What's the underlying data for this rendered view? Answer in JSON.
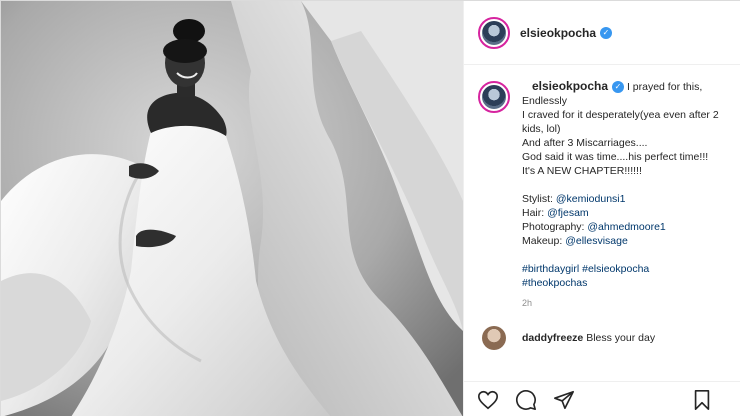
{
  "post": {
    "author": "elsieokpocha",
    "verified_glyph": "✓",
    "photo_alt": "black and white maternity portrait"
  },
  "caption": {
    "author": "elsieokpocha",
    "first_line_text": "I prayed for this,",
    "lines": [
      "Endlessly",
      "I craved for it desperately(yea even after 2 kids, lol)",
      "And after 3 Miscarriages....",
      "God said it was time....his perfect time!!!",
      "It's A NEW CHAPTER!!!!!!",
      ""
    ],
    "credits": [
      {
        "label": "Stylist:",
        "handle": "@kemiodunsi1"
      },
      {
        "label": "Hair:",
        "handle": "@fjesam"
      },
      {
        "label": "Photography:",
        "handle": "@ahmedmoore1"
      },
      {
        "label": "Makeup:",
        "handle": "@ellesvisage"
      }
    ],
    "hashtags_line1": "#birthdaygirl #elsieokpocha",
    "hashtags_line2": "#theokpochas",
    "time": "2h"
  },
  "reply": {
    "author": "daddyfreeze",
    "text": "Bless your day"
  },
  "actions": {
    "like": "heart-icon",
    "comment": "comment-icon",
    "share": "share-icon",
    "save": "bookmark-icon"
  },
  "colors": {
    "verified": "#3897f0",
    "mention": "#00376b",
    "muted": "#8e8e8e"
  }
}
